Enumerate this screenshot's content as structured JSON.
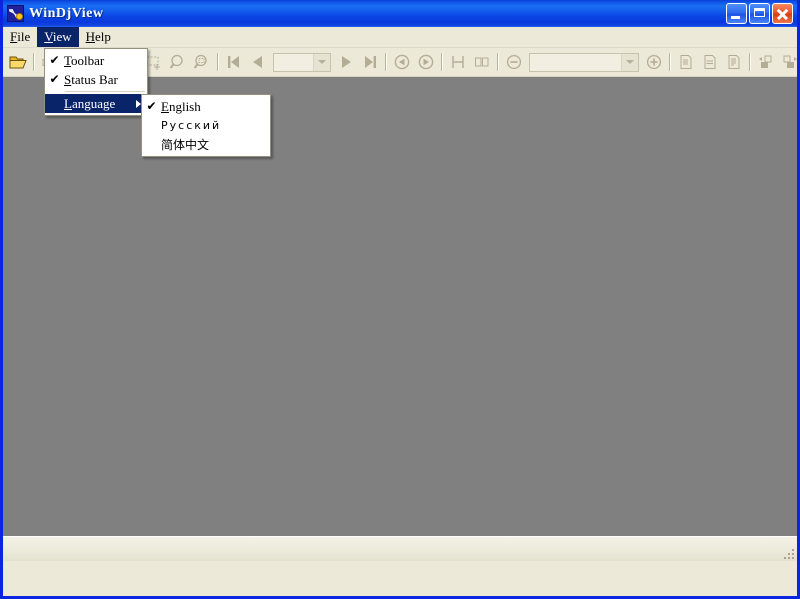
{
  "window": {
    "title": "WinDjView",
    "icon": "windjview-app-icon",
    "frame_color": "#0a24e0",
    "caption_buttons": [
      {
        "name": "minimize",
        "label": "Minimize"
      },
      {
        "name": "maximize",
        "label": "Maximize"
      },
      {
        "name": "close",
        "label": "Close"
      }
    ]
  },
  "menubar": {
    "items": [
      {
        "name": "file",
        "label": "File",
        "accel": "F",
        "active": false
      },
      {
        "name": "view",
        "label": "View",
        "accel": "V",
        "active": true
      },
      {
        "name": "help",
        "label": "Help",
        "accel": "H",
        "active": false
      }
    ]
  },
  "view_menu": {
    "items": [
      {
        "name": "toolbar",
        "label": "Toolbar",
        "accel": "T",
        "checked": true,
        "selected": false,
        "submenu": false
      },
      {
        "name": "status-bar",
        "label": "Status Bar",
        "accel": "S",
        "checked": true,
        "selected": false,
        "submenu": false
      },
      {
        "name": "language",
        "label": "Language",
        "accel": "L",
        "checked": false,
        "selected": true,
        "submenu": true
      }
    ]
  },
  "language_menu": {
    "items": [
      {
        "name": "english",
        "label": "English",
        "accel": "E",
        "checked": true,
        "script": "latin"
      },
      {
        "name": "russian",
        "label": "Русский",
        "checked": false,
        "script": "cyrillic"
      },
      {
        "name": "chinese-simplified",
        "label": "简体中文",
        "checked": false,
        "script": "cjk"
      }
    ]
  },
  "toolbar": {
    "background": "#ece9d8",
    "disabled_glyph_color": "#b3ad95",
    "page_combo": {
      "value": "",
      "placeholder": ""
    },
    "zoom_combo": {
      "value": "",
      "placeholder": ""
    },
    "buttons": [
      {
        "name": "open-file",
        "icon": "open-folder-icon",
        "enabled": true
      },
      {
        "name": "print",
        "icon": "printer-icon",
        "enabled": false
      },
      {
        "name": "find",
        "icon": "binoculars-icon",
        "enabled": false
      },
      {
        "name": "copy",
        "icon": "copy-icon",
        "enabled": false
      },
      {
        "name": "hand-tool",
        "icon": "hand-pointer-icon",
        "enabled": false
      },
      {
        "name": "select-rect-tool",
        "icon": "marquee-select-icon",
        "enabled": false
      },
      {
        "name": "zoom-tool",
        "icon": "magnifier-icon",
        "enabled": false
      },
      {
        "name": "zoom-rect-tool",
        "icon": "magnifier-rect-icon",
        "enabled": false
      },
      {
        "name": "first-page",
        "icon": "first-page-icon",
        "enabled": false
      },
      {
        "name": "previous-page",
        "icon": "previous-page-icon",
        "enabled": false
      },
      {
        "name": "next-page",
        "icon": "next-page-icon",
        "enabled": false
      },
      {
        "name": "last-page",
        "icon": "last-page-icon",
        "enabled": false
      },
      {
        "name": "go-back",
        "icon": "back-arrow-icon",
        "enabled": false
      },
      {
        "name": "go-forward",
        "icon": "forward-arrow-icon",
        "enabled": false
      },
      {
        "name": "single-page-layout",
        "icon": "single-page-icon",
        "enabled": false
      },
      {
        "name": "facing-pages-layout",
        "icon": "facing-pages-icon",
        "enabled": false
      },
      {
        "name": "zoom-out",
        "icon": "zoom-out-icon",
        "enabled": false
      },
      {
        "name": "zoom-in",
        "icon": "zoom-in-icon",
        "enabled": false
      },
      {
        "name": "fit-page",
        "icon": "fit-page-icon",
        "enabled": false
      },
      {
        "name": "fit-width",
        "icon": "fit-width-icon",
        "enabled": false
      },
      {
        "name": "actual-size",
        "icon": "actual-size-icon",
        "enabled": false
      },
      {
        "name": "rotate-left",
        "icon": "rotate-left-icon",
        "enabled": false
      },
      {
        "name": "rotate-right",
        "icon": "rotate-right-icon",
        "enabled": false
      }
    ]
  },
  "client": {
    "background": "#808080",
    "document_open": false
  },
  "statusbar": {
    "text": "",
    "resize_grip": true
  }
}
